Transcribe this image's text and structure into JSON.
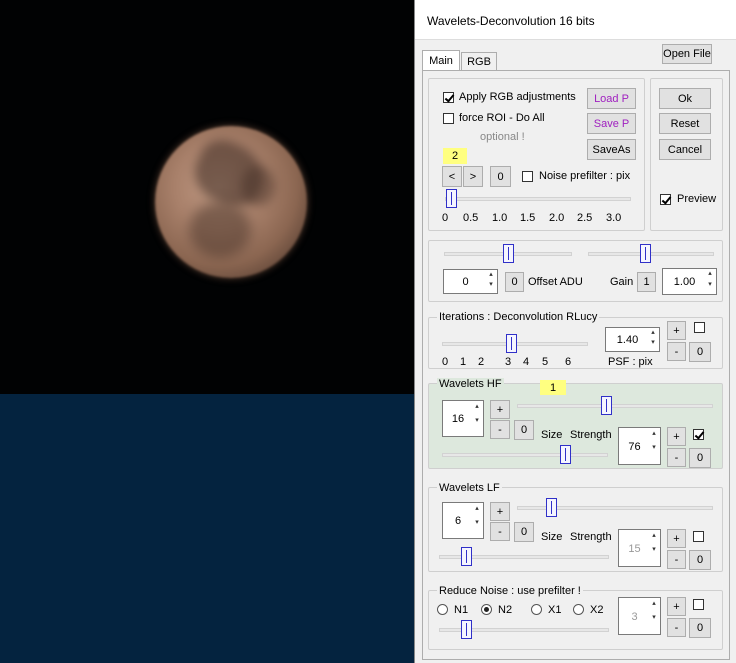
{
  "window_title": "Wavelets-Deconvolution 16 bits",
  "open_file": "Open File",
  "tabs": [
    "Main",
    "RGB"
  ],
  "top": {
    "apply_rgb": "Apply RGB adjustments",
    "force_roi": "force ROI - Do All",
    "optional": "optional !",
    "load_p": "Load P",
    "save_p": "Save P",
    "save_as": "SaveAs",
    "badge": "2",
    "prev": "<",
    "next": ">",
    "zero": "0",
    "noise_prefilter": "Noise prefilter : pix",
    "ticks": [
      "0",
      "0.5",
      "1.0",
      "1.5",
      "2.0",
      "2.5",
      "3.0"
    ]
  },
  "actions": {
    "ok": "Ok",
    "reset": "Reset",
    "cancel": "Cancel",
    "preview": "Preview"
  },
  "offset": {
    "value": "0",
    "zero": "0",
    "label": "Offset ADU",
    "gain_label": "Gain",
    "gain_btn": "1",
    "gain_value": "1.00"
  },
  "iterations": {
    "title": "Iterations : Deconvolution RLucy",
    "ticks": [
      "0",
      "1",
      "2",
      "3",
      "4",
      "5",
      "6"
    ],
    "psf_value": "1.40",
    "psf_label": "PSF : pix",
    "plus": "+",
    "minus": "-",
    "zero": "0"
  },
  "wavelets_hf": {
    "title": "Wavelets HF",
    "badge": "1",
    "size_value": "16",
    "size_label": "Size",
    "strength_label": "Strength",
    "strength_value": "76",
    "plus": "+",
    "minus": "-",
    "zero": "0"
  },
  "wavelets_lf": {
    "title": "Wavelets LF",
    "size_value": "6",
    "size_label": "Size",
    "strength_label": "Strength",
    "strength_value": "15",
    "plus": "+",
    "minus": "-",
    "zero": "0"
  },
  "reduce_noise": {
    "title": "Reduce Noise : use prefilter !",
    "options": [
      "N1",
      "N2",
      "X1",
      "X2"
    ],
    "value": "3",
    "plus": "+",
    "minus": "-",
    "zero": "0"
  },
  "colors": {
    "accent_purple": "#a020c0",
    "hf_bg": "#dde8dd",
    "thumb_blue": "#3030c8",
    "badge_yellow": "#ffff80"
  }
}
